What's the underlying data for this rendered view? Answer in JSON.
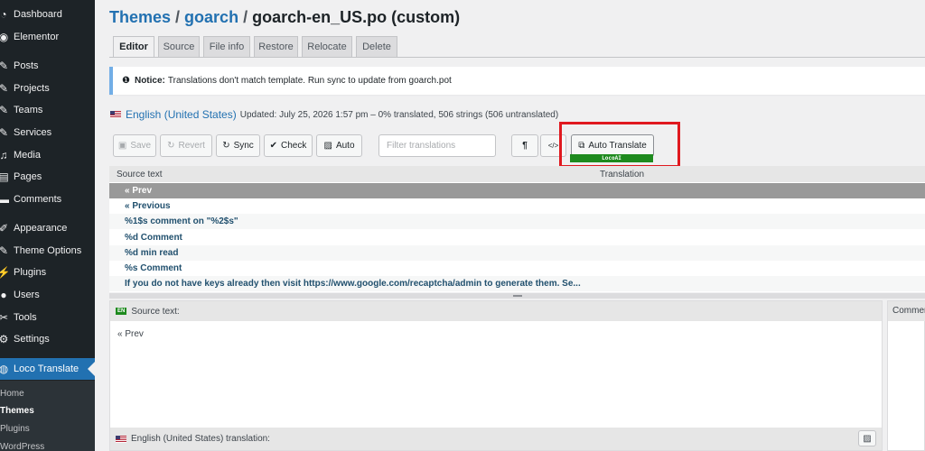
{
  "sidebar": {
    "items": [
      {
        "label": "Dashboard",
        "icon": "gauge-icon"
      },
      {
        "label": "Elementor",
        "icon": "elementor-icon"
      },
      {
        "label": "Posts",
        "icon": "pin-icon"
      },
      {
        "label": "Projects",
        "icon": "pin-icon"
      },
      {
        "label": "Teams",
        "icon": "pin-icon"
      },
      {
        "label": "Services",
        "icon": "pin-icon"
      },
      {
        "label": "Media",
        "icon": "media-icon"
      },
      {
        "label": "Pages",
        "icon": "pages-icon"
      },
      {
        "label": "Comments",
        "icon": "comment-icon"
      },
      {
        "label": "Appearance",
        "icon": "brush-icon"
      },
      {
        "label": "Theme Options",
        "icon": "pin-icon"
      },
      {
        "label": "Plugins",
        "icon": "plug-icon"
      },
      {
        "label": "Users",
        "icon": "user-icon"
      },
      {
        "label": "Tools",
        "icon": "wrench-icon"
      },
      {
        "label": "Settings",
        "icon": "settings-icon"
      },
      {
        "label": "Loco Translate",
        "icon": "globe-icon"
      }
    ],
    "submenu": [
      "Home",
      "Themes",
      "Plugins",
      "WordPress"
    ]
  },
  "heading": {
    "crumb1": "Themes",
    "crumb2": "goarch",
    "sep": "/",
    "file": "goarch-en_US.po (custom)"
  },
  "tabs": [
    "Editor",
    "Source",
    "File info",
    "Restore",
    "Relocate",
    "Delete"
  ],
  "notice": {
    "label": "Notice:",
    "text": "Translations don't match template. Run sync to update from goarch.pot"
  },
  "locale": {
    "language": "English (United States)",
    "meta": "Updated: July 25, 2026 1:57 pm – 0% translated, 506 strings (506 untranslated)"
  },
  "toolbar": {
    "save": "Save",
    "revert": "Revert",
    "sync": "Sync",
    "check": "Check",
    "auto": "Auto",
    "filter_placeholder": "Filter translations",
    "pilcrow": "¶",
    "code": "</>",
    "auto_translate": "Auto Translate",
    "locoai_badge": "LocoAI"
  },
  "table": {
    "col_source": "Source text",
    "col_translation": "Translation",
    "rows": [
      "« Prev",
      "« Previous",
      "%1$s comment on \"%2$s\"",
      "%d Comment",
      "%d min read",
      "%s Comment",
      "If you do not have keys already then visit https://www.google.com/recaptcha/admin to generate them. Se..."
    ]
  },
  "source_panel": {
    "badge": "EN",
    "title": "Source text:",
    "text": "« Prev",
    "translation_title": "English (United States) translation:"
  },
  "comments_panel": {
    "title": "Comments"
  }
}
